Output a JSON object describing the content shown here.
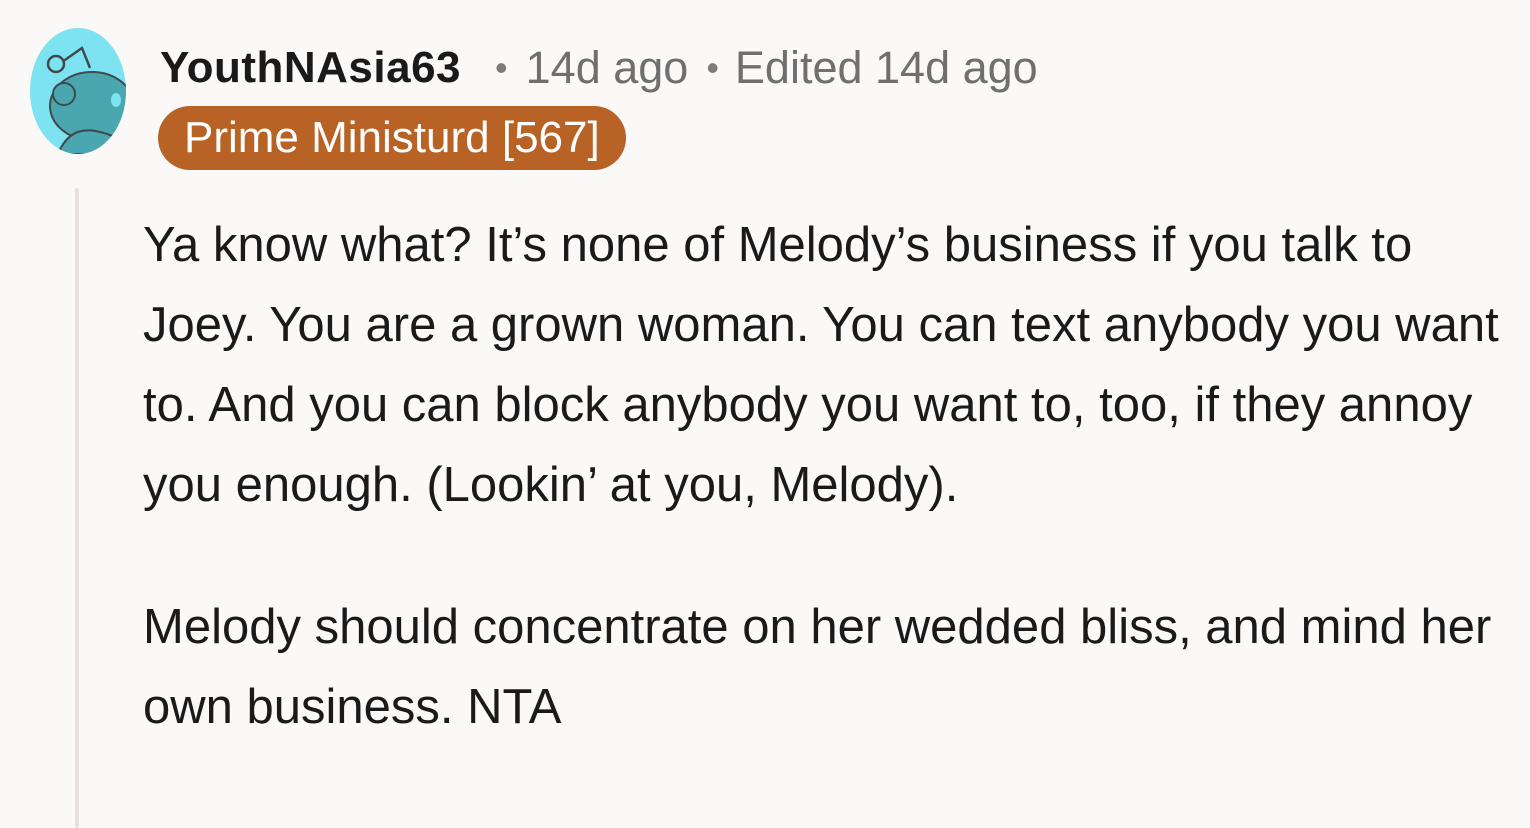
{
  "comment": {
    "author": "YouthNAsia63",
    "separator": "•",
    "timestamp": "14d ago",
    "edited": "Edited 14d ago",
    "flair": "Prime Ministurd [567]",
    "paragraphs": [
      "Ya know what? It’s none of Melody’s business if you talk to Joey. You are a grown woman. You can text anybody you want to. And you can block anybody you want to, too, if they annoy you enough. (Lookin’ at you, Melody).",
      "Melody should concentrate on her wedded bliss, and mind her own business. NTA"
    ]
  },
  "icons": {
    "avatar": "snoo-avatar-icon"
  },
  "colors": {
    "background": "#faf9f8",
    "avatar_bg": "#7de3f0",
    "flair_bg": "#b86225",
    "flair_text": "#ffffff",
    "meta_text": "#6f6f6f",
    "thread_line": "#e6e1de"
  }
}
